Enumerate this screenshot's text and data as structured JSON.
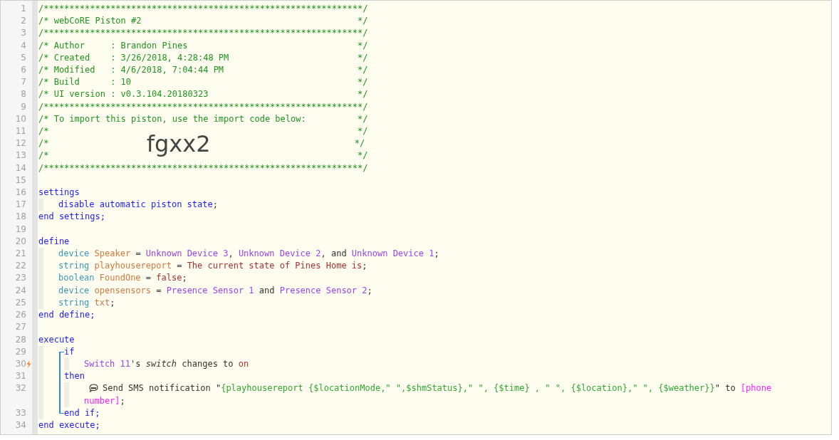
{
  "lines": [
    {
      "kind": "line",
      "number": "1",
      "tokens": [
        {
          "kind": "comment",
          "text": "/**************************************************************/"
        }
      ]
    },
    {
      "kind": "line",
      "number": "2",
      "tokens": [
        {
          "kind": "comment",
          "text": "/* webCoRE Piston #2                                          */"
        }
      ]
    },
    {
      "kind": "line",
      "number": "3",
      "tokens": [
        {
          "kind": "comment",
          "text": "/**************************************************************/"
        }
      ]
    },
    {
      "kind": "line",
      "number": "4",
      "tokens": [
        {
          "kind": "comment",
          "text": "/* Author     : Brandon Pines                                 */"
        }
      ]
    },
    {
      "kind": "line",
      "number": "5",
      "tokens": [
        {
          "kind": "comment",
          "text": "/* Created    : 3/26/2018, 4:28:48 PM                         */"
        }
      ]
    },
    {
      "kind": "line",
      "number": "6",
      "tokens": [
        {
          "kind": "comment",
          "text": "/* Modified   : 4/6/2018, 7:04:44 PM                          */"
        }
      ]
    },
    {
      "kind": "line",
      "number": "7",
      "tokens": [
        {
          "kind": "comment",
          "text": "/* Build      : 10                                            */"
        }
      ]
    },
    {
      "kind": "line",
      "number": "8",
      "tokens": [
        {
          "kind": "comment",
          "text": "/* UI version : v0.3.104.20180323                             */"
        }
      ]
    },
    {
      "kind": "line",
      "number": "9",
      "tokens": [
        {
          "kind": "comment",
          "text": "/**************************************************************/"
        }
      ]
    },
    {
      "kind": "line",
      "number": "10",
      "tokens": [
        {
          "kind": "comment",
          "text": "/* To import this piston, use the import code below:          */"
        }
      ]
    },
    {
      "kind": "line",
      "number": "11",
      "tokens": [
        {
          "kind": "comment",
          "text": "/*                                                            */"
        }
      ]
    },
    {
      "kind": "line",
      "number": "12",
      "tokens": [
        {
          "kind": "comment",
          "text": "/*                   "
        },
        {
          "kind": "big",
          "text": "fgxx2"
        },
        {
          "kind": "comment",
          "text": "                            */"
        }
      ]
    },
    {
      "kind": "line",
      "number": "13",
      "tokens": [
        {
          "kind": "comment",
          "text": "/*                                                            */"
        }
      ]
    },
    {
      "kind": "line",
      "number": "14",
      "tokens": [
        {
          "kind": "comment",
          "text": "/**************************************************************/"
        }
      ]
    },
    {
      "kind": "line",
      "number": "15"
    },
    {
      "kind": "line",
      "number": "16",
      "tokens": [
        {
          "kind": "keyword",
          "text": "settings"
        }
      ],
      "children": [
        {
          "kind": "line",
          "number": "17",
          "tokens": [
            {
              "kind": "keyword",
              "text": "disable automatic piston state"
            },
            {
              "kind": "plain",
              "text": ";"
            }
          ]
        }
      ]
    },
    {
      "kind": "line",
      "number": "18",
      "tokens": [
        {
          "kind": "keyword",
          "text": "end settings;"
        }
      ]
    },
    {
      "kind": "line",
      "number": "19"
    },
    {
      "kind": "line",
      "number": "20",
      "tokens": [
        {
          "kind": "keyword",
          "text": "define"
        }
      ],
      "children": [
        {
          "kind": "line",
          "number": "21",
          "tokens": [
            {
              "kind": "type",
              "text": "device "
            },
            {
              "kind": "variable",
              "text": "Speaker"
            },
            {
              "kind": "plain",
              "text": " = "
            },
            {
              "kind": "device",
              "text": "Unknown Device 3"
            },
            {
              "kind": "plain",
              "text": ", "
            },
            {
              "kind": "device",
              "text": "Unknown Device 2"
            },
            {
              "kind": "plain",
              "text": ", and "
            },
            {
              "kind": "device",
              "text": "Unknown Device 1"
            },
            {
              "kind": "plain",
              "text": ";"
            }
          ]
        },
        {
          "kind": "line",
          "number": "22",
          "tokens": [
            {
              "kind": "type",
              "text": "string "
            },
            {
              "kind": "variable",
              "text": "playhousereport"
            },
            {
              "kind": "plain",
              "text": " = "
            },
            {
              "kind": "literal",
              "text": "The current state of Pines Home is"
            },
            {
              "kind": "plain",
              "text": ";"
            }
          ]
        },
        {
          "kind": "line",
          "number": "23",
          "tokens": [
            {
              "kind": "type",
              "text": "boolean "
            },
            {
              "kind": "variable",
              "text": "FoundOne"
            },
            {
              "kind": "plain",
              "text": " = "
            },
            {
              "kind": "literal",
              "text": "false"
            },
            {
              "kind": "plain",
              "text": ";"
            }
          ]
        },
        {
          "kind": "line",
          "number": "24",
          "tokens": [
            {
              "kind": "type",
              "text": "device "
            },
            {
              "kind": "variable",
              "text": "opensensors"
            },
            {
              "kind": "plain",
              "text": " = "
            },
            {
              "kind": "device",
              "text": "Presence Sensor 1"
            },
            {
              "kind": "plain",
              "text": " and "
            },
            {
              "kind": "device",
              "text": "Presence Sensor 2"
            },
            {
              "kind": "plain",
              "text": ";"
            }
          ]
        },
        {
          "kind": "line",
          "number": "25",
          "tokens": [
            {
              "kind": "type",
              "text": "string "
            },
            {
              "kind": "variable",
              "text": "txt"
            },
            {
              "kind": "plain",
              "text": ";"
            }
          ]
        }
      ]
    },
    {
      "kind": "line",
      "number": "26",
      "tokens": [
        {
          "kind": "keyword",
          "text": "end define;"
        }
      ]
    },
    {
      "kind": "line",
      "number": "27"
    },
    {
      "kind": "line",
      "number": "28",
      "tokens": [
        {
          "kind": "keyword",
          "text": "execute"
        }
      ],
      "children": [
        {
          "kind": "group",
          "children": [
            {
              "kind": "line",
              "number": "29",
              "tokens": [
                {
                  "kind": "keyword",
                  "text": "if"
                }
              ],
              "children": [
                {
                  "kind": "line",
                  "number": "30",
                  "trigger": true,
                  "tokens": [
                    {
                      "kind": "device",
                      "text": "Switch 11"
                    },
                    {
                      "kind": "plain",
                      "text": "'s "
                    },
                    {
                      "kind": "attribute",
                      "text": "switch"
                    },
                    {
                      "kind": "plain",
                      "text": " changes to "
                    },
                    {
                      "kind": "value",
                      "text": "on"
                    }
                  ]
                }
              ]
            },
            {
              "kind": "line",
              "number": "31",
              "tokens": [
                {
                  "kind": "keyword",
                  "text": "then"
                }
              ],
              "children": [
                {
                  "kind": "action",
                  "number": "32",
                  "tokens": [
                    {
                      "kind": "plain",
                      "text": "Send SMS notification \""
                    },
                    {
                      "kind": "expression",
                      "text": "{playhousereport {$locationMode,\" \",$shmStatus},\" \", {$time} , \" \", {$location},\" \", {$weather}}"
                    },
                    {
                      "kind": "plain",
                      "text": "\" to "
                    },
                    {
                      "kind": "argument",
                      "text": "[phone number]"
                    },
                    {
                      "kind": "plain",
                      "text": ";"
                    }
                  ]
                }
              ]
            },
            {
              "kind": "line",
              "number": "33",
              "tokens": [
                {
                  "kind": "keyword",
                  "text": "end if;"
                }
              ]
            }
          ]
        }
      ]
    },
    {
      "kind": "line",
      "number": "34",
      "tokens": [
        {
          "kind": "keyword",
          "text": "end execute;"
        }
      ]
    }
  ]
}
